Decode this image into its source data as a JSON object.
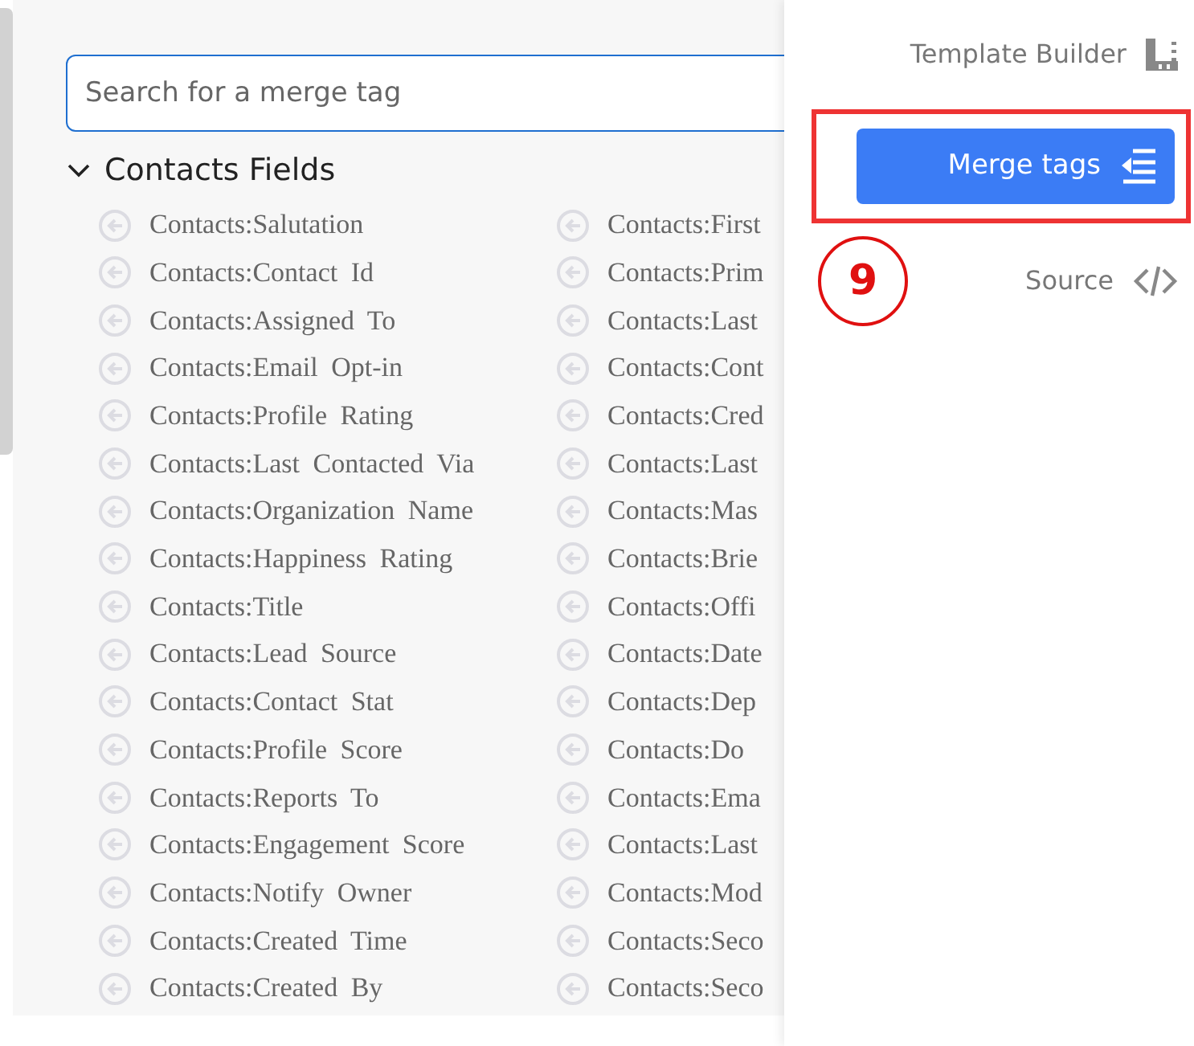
{
  "search": {
    "placeholder": "Search for a merge tag"
  },
  "section": {
    "title": "Contacts Fields",
    "expanded": true
  },
  "fields": [
    {
      "column_1": "Contacts:Salutation",
      "column_2": "Contacts:First"
    },
    {
      "column_1": "Contacts:Contact Id",
      "column_2": "Contacts:Prim"
    },
    {
      "column_1": "Contacts:Assigned To",
      "column_2": "Contacts:Last"
    },
    {
      "column_1": "Contacts:Email Opt-in",
      "column_2": "Contacts:Cont"
    },
    {
      "column_1": "Contacts:Profile Rating",
      "column_2": "Contacts:Cred"
    },
    {
      "column_1": "Contacts:Last Contacted Via",
      "column_2": "Contacts:Last"
    },
    {
      "column_1": "Contacts:Organization Name",
      "column_2": "Contacts:Mas"
    },
    {
      "column_1": "Contacts:Happiness Rating",
      "column_2": "Contacts:Brie"
    },
    {
      "column_1": "Contacts:Title",
      "column_2": "Contacts:Offi"
    },
    {
      "column_1": "Contacts:Lead Source",
      "column_2": "Contacts:Date"
    },
    {
      "column_1": "Contacts:Contact Stat",
      "column_2": "Contacts:Dep"
    },
    {
      "column_1": "Contacts:Profile Score",
      "column_2": "Contacts:Do"
    },
    {
      "column_1": "Contacts:Reports To",
      "column_2": "Contacts:Ema"
    },
    {
      "column_1": "Contacts:Engagement Score",
      "column_2": "Contacts:Last"
    },
    {
      "column_1": "Contacts:Notify Owner",
      "column_2": "Contacts:Mod"
    },
    {
      "column_1": "Contacts:Created Time",
      "column_2": "Contacts:Seco"
    },
    {
      "column_1": "Contacts:Created By",
      "column_2": "Contacts:Seco"
    }
  ],
  "side_menu": [
    {
      "kind": "builder",
      "label": "Template Builder",
      "selected": false
    },
    {
      "kind": "merge",
      "label": "Merge tags",
      "selected": true
    },
    {
      "kind": "source",
      "label": "Source",
      "selected": false
    }
  ],
  "annotation": {
    "number": "9"
  }
}
